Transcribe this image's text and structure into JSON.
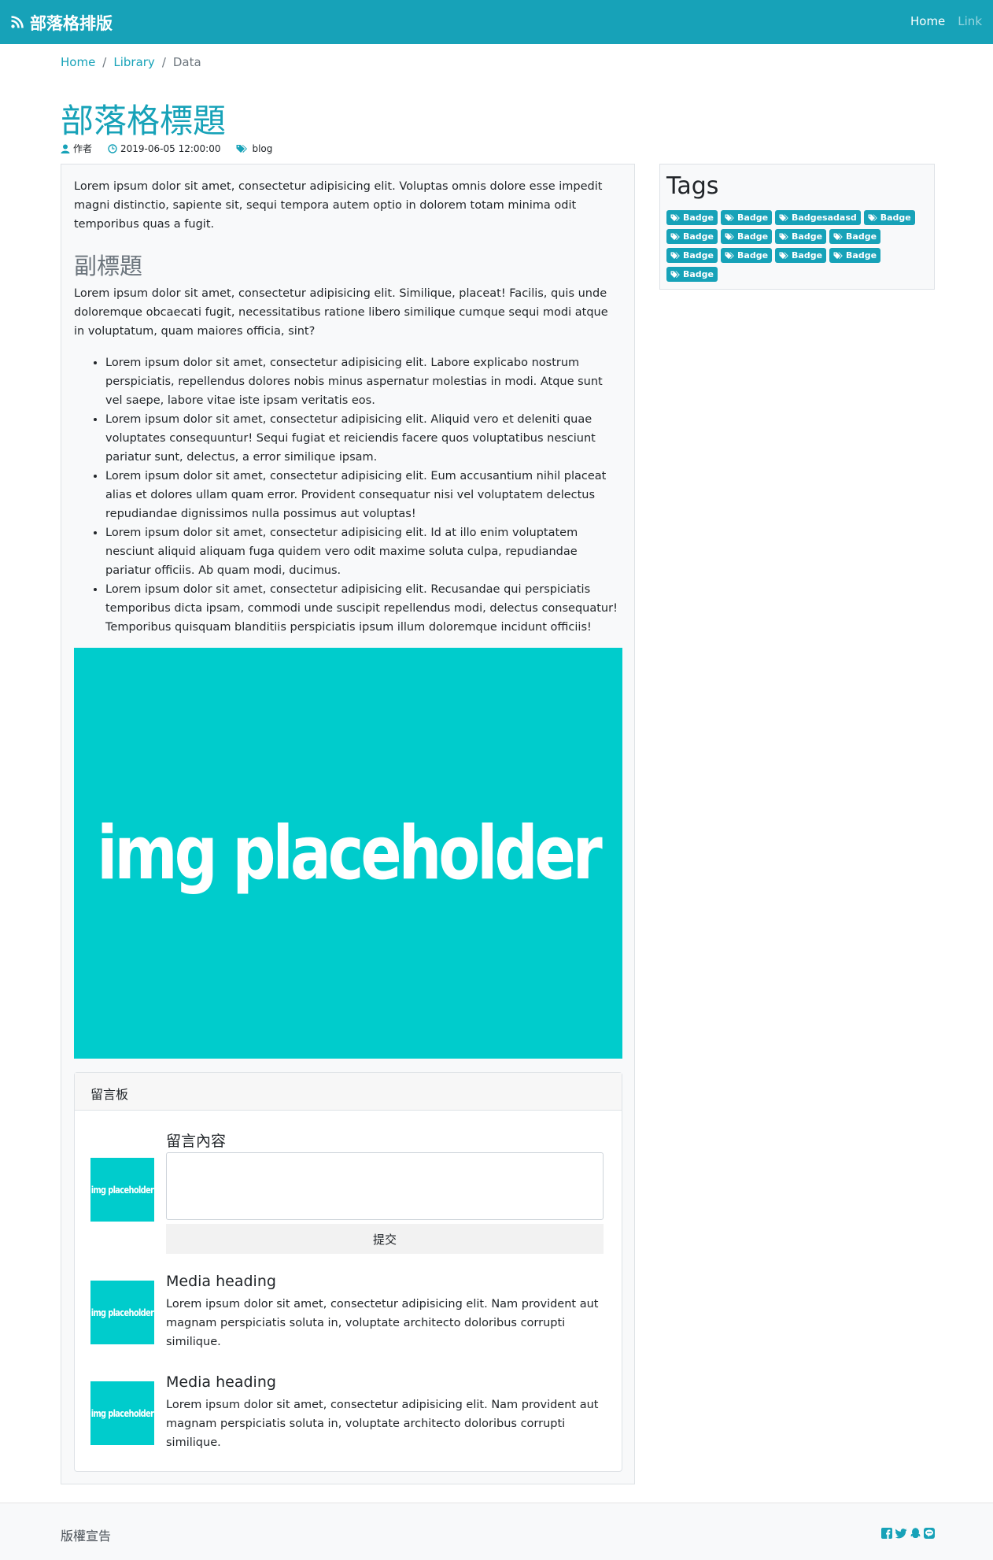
{
  "navbar": {
    "brand": "部落格排版",
    "links": [
      {
        "label": "Home",
        "active": true
      },
      {
        "label": "Link",
        "active": false
      }
    ]
  },
  "breadcrumb": [
    "Home",
    "Library",
    "Data"
  ],
  "post": {
    "title": "部落格標題",
    "author": "作者",
    "date": "2019-06-05 12:00:00",
    "category": "blog",
    "intro": "Lorem ipsum dolor sit amet, consectetur adipisicing elit. Voluptas omnis dolore esse impedit magni distinctio, sapiente sit, sequi tempora autem optio in dolorem totam minima odit temporibus quas a fugit.",
    "subtitle": "副標題",
    "sub_paragraph": "Lorem ipsum dolor sit amet, consectetur adipisicing elit. Similique, placeat! Facilis, quis unde doloremque obcaecati fugit, necessitatibus ratione libero similique cumque sequi modi atque in voluptatum, quam maiores officia, sint?",
    "bullets": [
      "Lorem ipsum dolor sit amet, consectetur adipisicing elit. Labore explicabo nostrum perspiciatis, repellendus dolores nobis minus aspernatur molestias in modi. Atque sunt vel saepe, labore vitae iste ipsam veritatis eos.",
      "Lorem ipsum dolor sit amet, consectetur adipisicing elit. Aliquid vero et deleniti quae voluptates consequuntur! Sequi fugiat et reiciendis facere quos voluptatibus nesciunt pariatur sunt, delectus, a error similique ipsam.",
      "Lorem ipsum dolor sit amet, consectetur adipisicing elit. Eum accusantium nihil placeat alias et dolores ullam quam error. Provident consequatur nisi vel voluptatem delectus repudiandae dignissimos nulla possimus aut voluptas!",
      "Lorem ipsum dolor sit amet, consectetur adipisicing elit. Id at illo enim voluptatem nesciunt aliquid aliquam fuga quidem vero odit maxime soluta culpa, repudiandae pariatur officiis. Ab quam modi, ducimus.",
      "Lorem ipsum dolor sit amet, consectetur adipisicing elit. Recusandae qui perspiciatis temporibus dicta ipsam, commodi unde suscipit repellendus modi, delectus consequatur! Temporibus quisquam blanditiis perspiciatis ipsum illum doloremque incidunt officiis!"
    ],
    "image_text": "img placeholder"
  },
  "comments": {
    "header": "留言板",
    "form_label": "留言內容",
    "submit_label": "提交",
    "avatar_text": "img placeholder",
    "items": [
      {
        "heading": "Media heading",
        "text": "Lorem ipsum dolor sit amet, consectetur adipisicing elit. Nam provident aut magnam perspiciatis soluta in, voluptate architecto doloribus corrupti similique."
      },
      {
        "heading": "Media heading",
        "text": "Lorem ipsum dolor sit amet, consectetur adipisicing elit. Nam provident aut magnam perspiciatis soluta in, voluptate architecto doloribus corrupti similique."
      }
    ]
  },
  "tags": {
    "title": "Tags",
    "badges": [
      "Badge",
      "Badge",
      "Badgesadasd",
      "Badge",
      "Badge",
      "Badge",
      "Badge",
      "Badge",
      "Badge",
      "Badge",
      "Badge",
      "Badge",
      "Badge"
    ]
  },
  "footer": {
    "copyright": "版權宣告",
    "social_icons": [
      "facebook-icon",
      "twitter-icon",
      "qq-icon",
      "line-icon"
    ]
  },
  "colors": {
    "primary": "#17a2b8",
    "placeholder": "#00cccc",
    "card_bg": "#f8f9fa"
  }
}
